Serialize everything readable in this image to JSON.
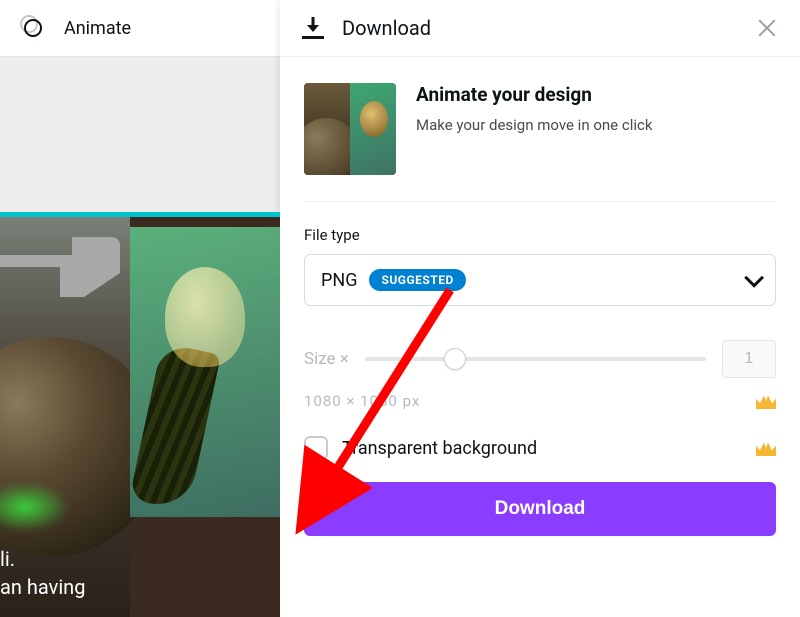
{
  "topbar": {
    "animate_label": "Animate"
  },
  "canvas": {
    "line1": "li.",
    "line2": "an having"
  },
  "panel": {
    "title": "Download",
    "promo": {
      "heading": "Animate your design",
      "subtext": "Make your design move in one click"
    },
    "filetype": {
      "label": "File type",
      "value": "PNG",
      "badge": "SUGGESTED"
    },
    "size": {
      "label": "Size ×",
      "value": "1",
      "dimensions": "1080 × 1080 px"
    },
    "transparent": {
      "label": "Transparent background"
    },
    "download_button": "Download"
  }
}
